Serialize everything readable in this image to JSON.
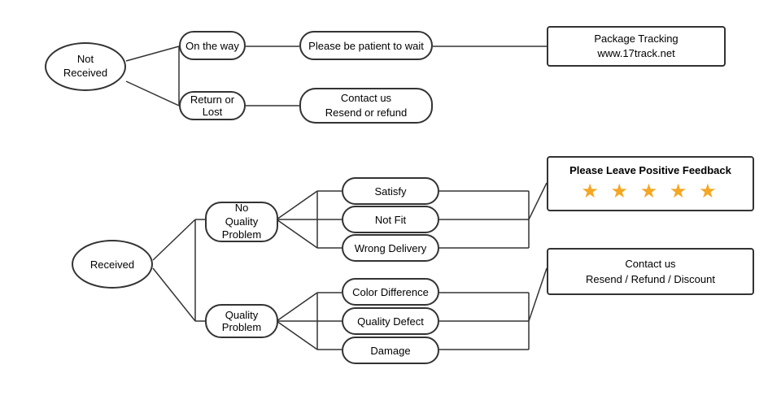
{
  "nodes": {
    "not_received": {
      "label": "Not\nReceived"
    },
    "on_the_way": {
      "label": "On the way"
    },
    "patient_wait": {
      "label": "Please be patient to wait"
    },
    "package_tracking": {
      "label": "Package Tracking\nwww.17track.net"
    },
    "return_or_lost": {
      "label": "Return or Lost"
    },
    "contact_resend": {
      "label": "Contact us\nResend or refund"
    },
    "received": {
      "label": "Received"
    },
    "no_quality_problem": {
      "label": "No\nQuality Problem"
    },
    "quality_problem": {
      "label": "Quality Problem"
    },
    "satisfy": {
      "label": "Satisfy"
    },
    "not_fit": {
      "label": "Not Fit"
    },
    "wrong_delivery": {
      "label": "Wrong Delivery"
    },
    "color_difference": {
      "label": "Color Difference"
    },
    "quality_defect": {
      "label": "Quality Defect"
    },
    "damage": {
      "label": "Damage"
    },
    "please_leave_feedback": {
      "title": "Please Leave Positive Feedback",
      "stars": "★ ★ ★ ★ ★"
    },
    "contact_resend_refund": {
      "label": "Contact us\nResend / Refund / Discount"
    }
  }
}
